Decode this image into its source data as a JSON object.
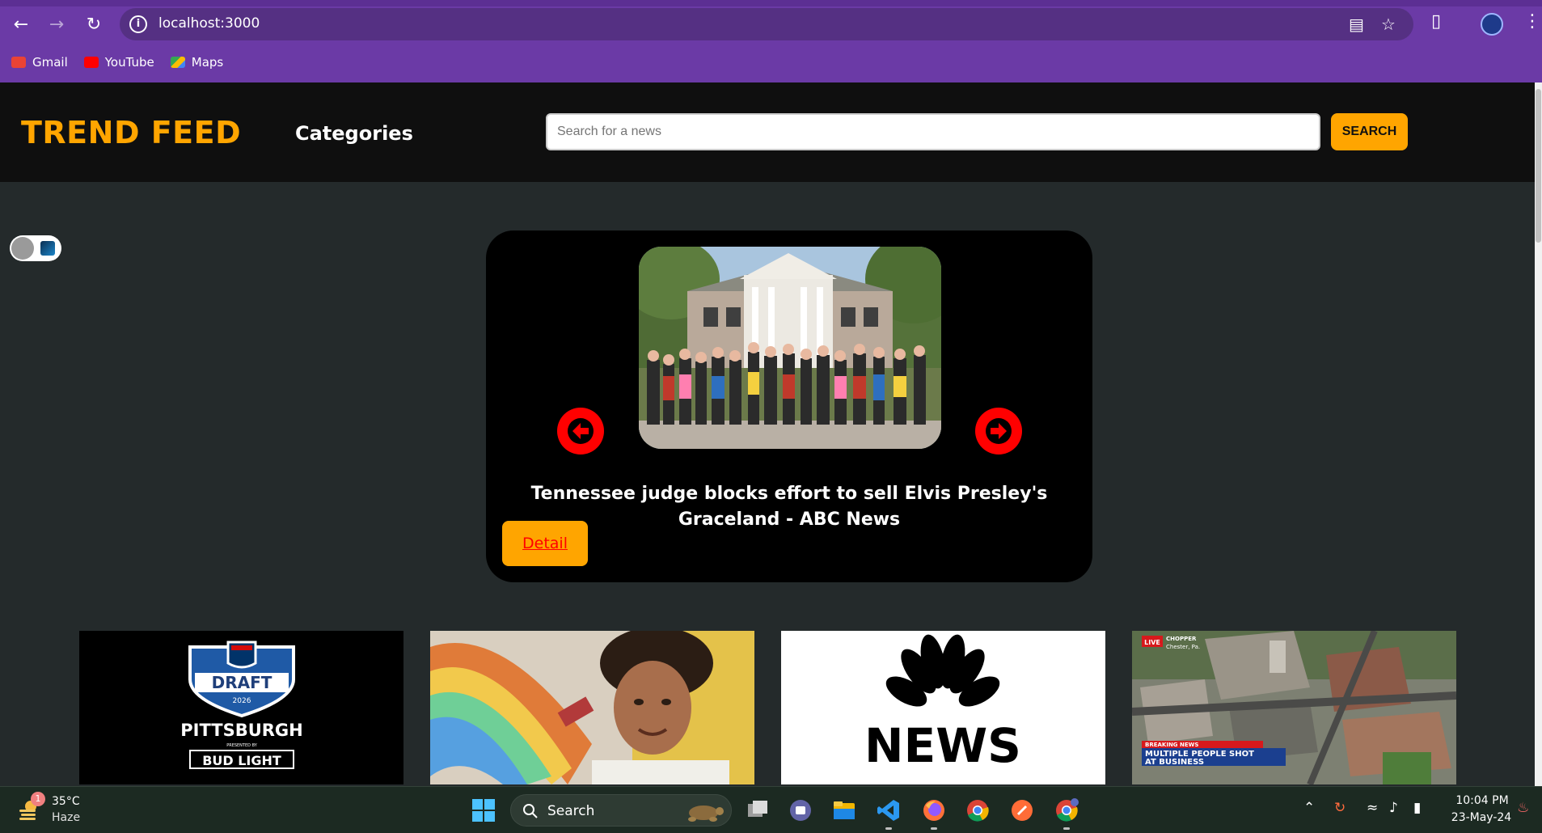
{
  "browser": {
    "url": "localhost:3000",
    "bookmarks": [
      {
        "label": "Gmail",
        "icon": "gmail-icon"
      },
      {
        "label": "YouTube",
        "icon": "youtube-icon"
      },
      {
        "label": "Maps",
        "icon": "maps-icon"
      }
    ]
  },
  "header": {
    "logo": "TREND FEED",
    "categories_label": "Categories",
    "search_placeholder": "Search for a news",
    "search_button": "SEARCH"
  },
  "hero": {
    "title": "Tennessee judge blocks effort to sell Elvis Presley's Graceland - ABC News",
    "detail_label": "Detail"
  },
  "cards": [
    {
      "image": "nfl-draft-logo",
      "text": [
        "DRAFT",
        "2026",
        "PITTSBURGH",
        "PRESENTED BY",
        "BUD LIGHT"
      ]
    },
    {
      "image": "student-portrait"
    },
    {
      "image": "nbc-news-logo",
      "text": [
        "NEWS"
      ]
    },
    {
      "image": "aerial-breaking-news",
      "text": [
        "LIVE",
        "CHOPPER",
        "Chester, Pa.",
        "BREAKING NEWS",
        "MULTIPLE PEOPLE SHOT",
        "AT BUSINESS"
      ]
    }
  ],
  "taskbar": {
    "weather_badge": "1",
    "temperature": "35°C",
    "condition": "Haze",
    "search_label": "Search",
    "time": "10:04 PM",
    "date": "23-May-24"
  },
  "colors": {
    "accent": "#ffa500",
    "browser_frame": "#6b3aa6",
    "header_bg": "#0f0f0f",
    "page_bg": "#242a2b",
    "arrow": "#ff0000"
  }
}
